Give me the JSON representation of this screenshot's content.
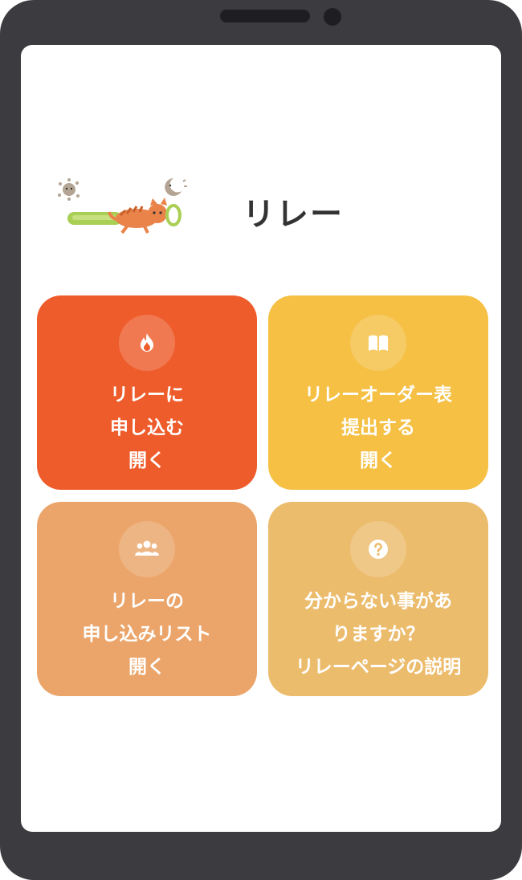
{
  "page": {
    "title": "リレー"
  },
  "cards": [
    {
      "icon": "fire-icon",
      "color": "#ee5c2b",
      "lines": [
        "リレーに",
        "申し込む",
        "開く"
      ]
    },
    {
      "icon": "book-icon",
      "color": "#f5c044",
      "lines": [
        "リレーオーダー表",
        "提出する",
        "開く"
      ]
    },
    {
      "icon": "users-icon",
      "color": "#eba56a",
      "lines": [
        "リレーの",
        "申し込みリスト",
        "開く"
      ]
    },
    {
      "icon": "question-icon",
      "color": "#ecbc6d",
      "lines": [
        "分からない事があ",
        "りますか？",
        "リレーページの説明"
      ]
    }
  ]
}
